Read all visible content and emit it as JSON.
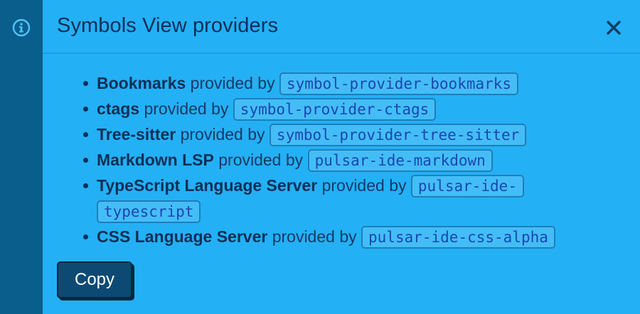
{
  "notification": {
    "title": "Symbols View providers",
    "icons": {
      "info": "info-icon",
      "close": "close-icon"
    },
    "by_text": "provided by",
    "providers": [
      {
        "name": "Bookmarks",
        "package": "symbol-provider-bookmarks"
      },
      {
        "name": "ctags",
        "package": "symbol-provider-ctags"
      },
      {
        "name": "Tree-sitter",
        "package": "symbol-provider-tree-sitter"
      },
      {
        "name": "Markdown LSP",
        "package": "pulsar-ide-markdown"
      },
      {
        "name": "TypeScript Language Server",
        "package": "pulsar-ide-typescript"
      },
      {
        "name": "CSS Language Server",
        "package": "pulsar-ide-css-alpha"
      }
    ],
    "copy_label": "Copy"
  },
  "colors": {
    "background": "#24b0f5",
    "side_strip": "#0a5e8c",
    "text": "#0f2f57",
    "code_text": "#1a47b0",
    "button": "#0d4a73"
  }
}
